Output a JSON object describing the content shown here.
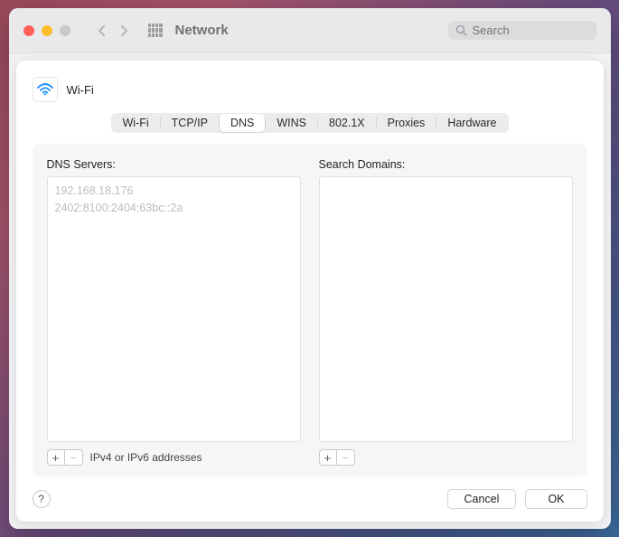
{
  "titlebar": {
    "title": "Network",
    "search_placeholder": "Search"
  },
  "sheet": {
    "header": {
      "network_name": "Wi-Fi"
    },
    "tabs": [
      {
        "label": "Wi-Fi",
        "active": false
      },
      {
        "label": "TCP/IP",
        "active": false
      },
      {
        "label": "DNS",
        "active": true
      },
      {
        "label": "WINS",
        "active": false
      },
      {
        "label": "802.1X",
        "active": false
      },
      {
        "label": "Proxies",
        "active": false
      },
      {
        "label": "Hardware",
        "active": false
      }
    ],
    "dns_servers": {
      "label": "DNS Servers:",
      "items": [
        "192.168.18.176",
        "2402:8100:2404:63bc::2a"
      ],
      "hint": "IPv4 or IPv6 addresses"
    },
    "search_domains": {
      "label": "Search Domains:",
      "items": []
    },
    "buttons": {
      "help": "?",
      "cancel": "Cancel",
      "ok": "OK",
      "add": "+",
      "remove": "−"
    }
  }
}
